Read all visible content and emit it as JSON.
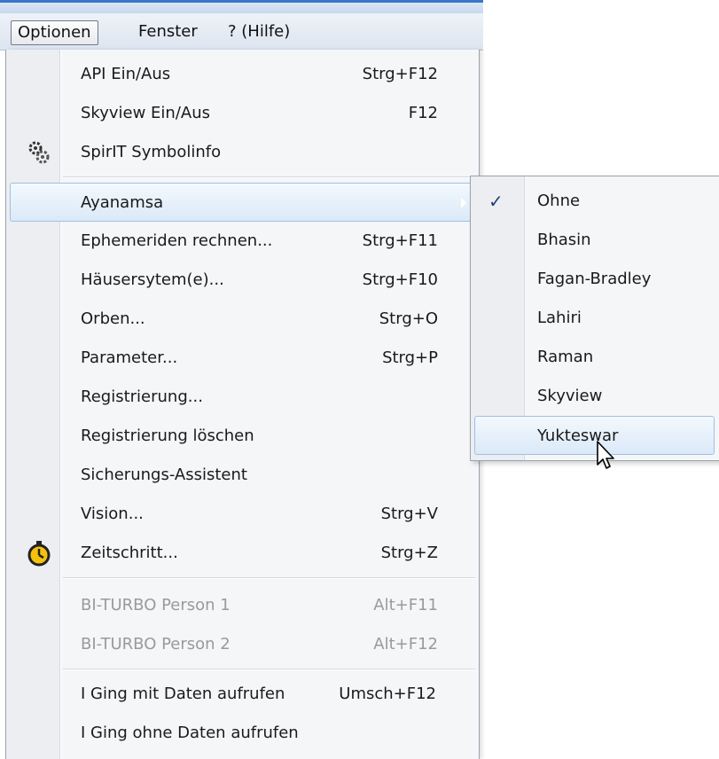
{
  "menubar": {
    "items": [
      "Optionen",
      "Fenster",
      "? (Hilfe)"
    ]
  },
  "menu": {
    "items": [
      {
        "label": "API Ein/Aus",
        "shortcut": "Strg+F12"
      },
      {
        "label": "Skyview Ein/Aus",
        "shortcut": "F12"
      },
      {
        "label": "SpirIT Symbolinfo",
        "shortcut": "",
        "icon": "gears-icon"
      },
      {
        "label": "Ayanamsa",
        "shortcut": "",
        "submenu": true
      },
      {
        "label": "Ephemeriden rechnen...",
        "shortcut": "Strg+F11"
      },
      {
        "label": "Häusersytem(e)...",
        "shortcut": "Strg+F10"
      },
      {
        "label": "Orben...",
        "shortcut": "Strg+O"
      },
      {
        "label": "Parameter...",
        "shortcut": "Strg+P"
      },
      {
        "label": "Registrierung...",
        "shortcut": ""
      },
      {
        "label": "Registrierung löschen",
        "shortcut": ""
      },
      {
        "label": "Sicherungs-Assistent",
        "shortcut": ""
      },
      {
        "label": "Vision...",
        "shortcut": "Strg+V"
      },
      {
        "label": "Zeitschritt...",
        "shortcut": "Strg+Z",
        "icon": "stopwatch-icon"
      },
      {
        "label": "BI-TURBO Person 1",
        "shortcut": "Alt+F11",
        "disabled": true
      },
      {
        "label": "BI-TURBO Person 2",
        "shortcut": "Alt+F12",
        "disabled": true
      },
      {
        "label": "I Ging mit Daten aufrufen",
        "shortcut": "Umsch+F12"
      },
      {
        "label": "I Ging ohne Daten aufrufen",
        "shortcut": ""
      }
    ]
  },
  "submenu": {
    "items": [
      {
        "label": "Ohne",
        "checked": true
      },
      {
        "label": "Bhasin"
      },
      {
        "label": "Fagan-Bradley"
      },
      {
        "label": "Lahiri"
      },
      {
        "label": "Raman"
      },
      {
        "label": "Skyview"
      },
      {
        "label": "Yukteswar",
        "hovered": true
      }
    ],
    "check_glyph": "✓"
  },
  "colors": {
    "highlight_border": "#9fc0e4",
    "highlight_fill": "#dbe9f8",
    "disabled_text": "#9a9a9a",
    "title_bar": "#3a78c8"
  }
}
